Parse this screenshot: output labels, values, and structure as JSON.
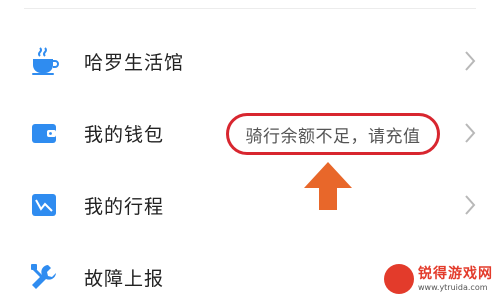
{
  "menu": {
    "items": [
      {
        "label": "哈罗生活馆",
        "icon": "coffee-cup-icon"
      },
      {
        "label": "我的钱包",
        "icon": "wallet-icon"
      },
      {
        "label": "我的行程",
        "icon": "trip-chart-icon"
      },
      {
        "label": "故障上报",
        "icon": "wrench-icon"
      }
    ]
  },
  "wallet_notice": "骑行余额不足，请充值",
  "watermark": {
    "title": "锐得游戏网",
    "url": "www.ytruida.com"
  },
  "colors": {
    "icon_blue": "#2f8cf0",
    "highlight_red": "#d8262f",
    "arrow_orange": "#e8672a",
    "chevron_gray": "#b8b8b8"
  }
}
